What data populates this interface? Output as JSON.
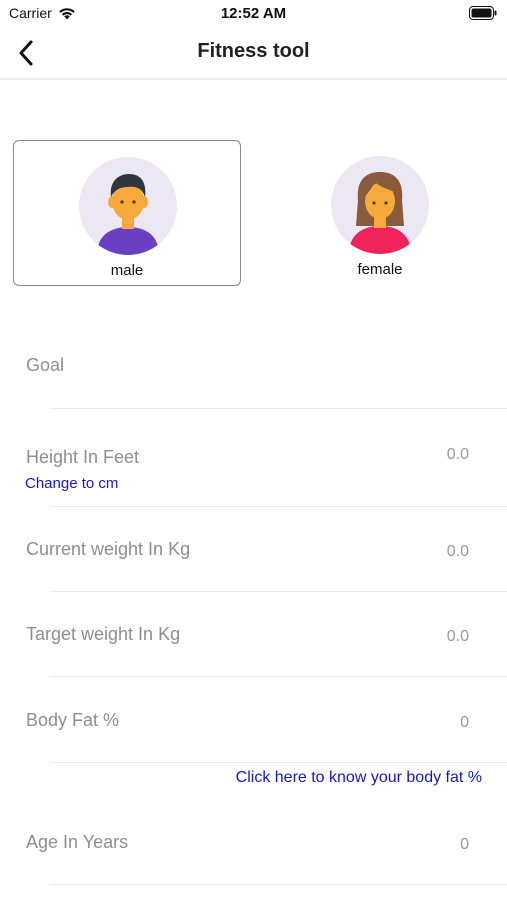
{
  "status_bar": {
    "carrier": "Carrier",
    "time": "12:52 AM"
  },
  "nav": {
    "title": "Fitness tool"
  },
  "gender": {
    "selected": "male",
    "options": [
      {
        "label": "male"
      },
      {
        "label": "female"
      }
    ]
  },
  "form": {
    "goal_label": "Goal",
    "goal_value": "",
    "height_label": "Height In Feet",
    "height_value": "0.0",
    "height_toggle_link": "Change to cm",
    "current_weight_label": "Current weight In Kg",
    "current_weight_value": "0.0",
    "target_weight_label": "Target weight In Kg",
    "target_weight_value": "0.0",
    "body_fat_label": "Body Fat %",
    "body_fat_value": "0",
    "body_fat_link": "Click here to know your body fat %",
    "age_label": "Age In Years",
    "age_value": "0"
  },
  "colors": {
    "link": "#1717c8",
    "label": "#8e8e93",
    "value": "#9a9a9a",
    "avatar_bg": "#ebe7f3",
    "male_shirt": "#6a3fc4",
    "female_shirt": "#f0245a",
    "skin": "#f7a93b"
  },
  "icons": {
    "back": "chevron-left-icon",
    "wifi": "wifi-icon",
    "battery": "battery-icon"
  }
}
